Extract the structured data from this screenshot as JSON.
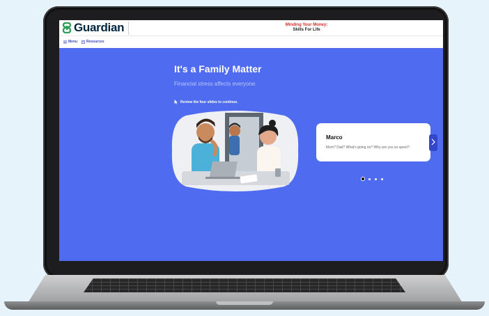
{
  "header": {
    "brand": "Guardian",
    "course_title_line1": "Minding Your Money:",
    "course_title_line2": "Skills For Life"
  },
  "nav": {
    "menu_label": "Menu",
    "resources_label": "Resources"
  },
  "slide": {
    "title": "It's a Family Matter",
    "subtitle": "Financial stress affects everyone.",
    "instruction": "Review the four slides to continue."
  },
  "card": {
    "speaker": "Marco",
    "text": "Mom? Dad? What's going on? Why are you so upset?"
  },
  "pagination": {
    "total": 4,
    "current": 1
  },
  "colors": {
    "slide_background": "#4f6cf0",
    "brand_navy": "#00263e",
    "brand_green": "#2e9e5b",
    "course_title_red": "#d62b2b",
    "next_button": "#3547c9"
  },
  "icons": [
    "menu-icon",
    "resources-icon",
    "cursor-icon",
    "chevron-right-icon"
  ]
}
